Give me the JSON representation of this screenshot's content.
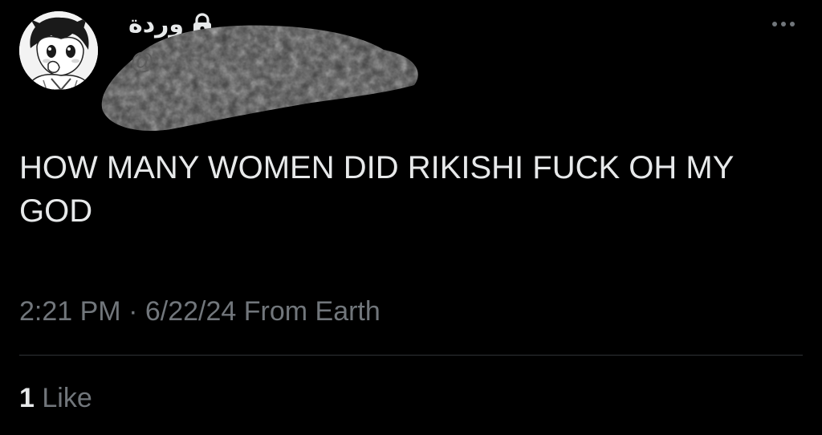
{
  "colors": {
    "background": "#000000",
    "primary_text": "#e7e9ea",
    "secondary_text": "#71767b",
    "divider": "#2f3336"
  },
  "author": {
    "display_name": "وردة",
    "handle": "@",
    "protected_icon": "lock-icon",
    "avatar_icon": "anime-avatar-icon"
  },
  "tweet": {
    "text": "HOW MANY WOMEN DID RIKISHI FUCK OH MY GOD",
    "time": "2:21 PM",
    "separator": " · ",
    "date": "6/22/24",
    "source": " From Earth"
  },
  "stats": {
    "likes_count": "1",
    "likes_label": " Like"
  },
  "more_icon": "more-horizontal-icon"
}
